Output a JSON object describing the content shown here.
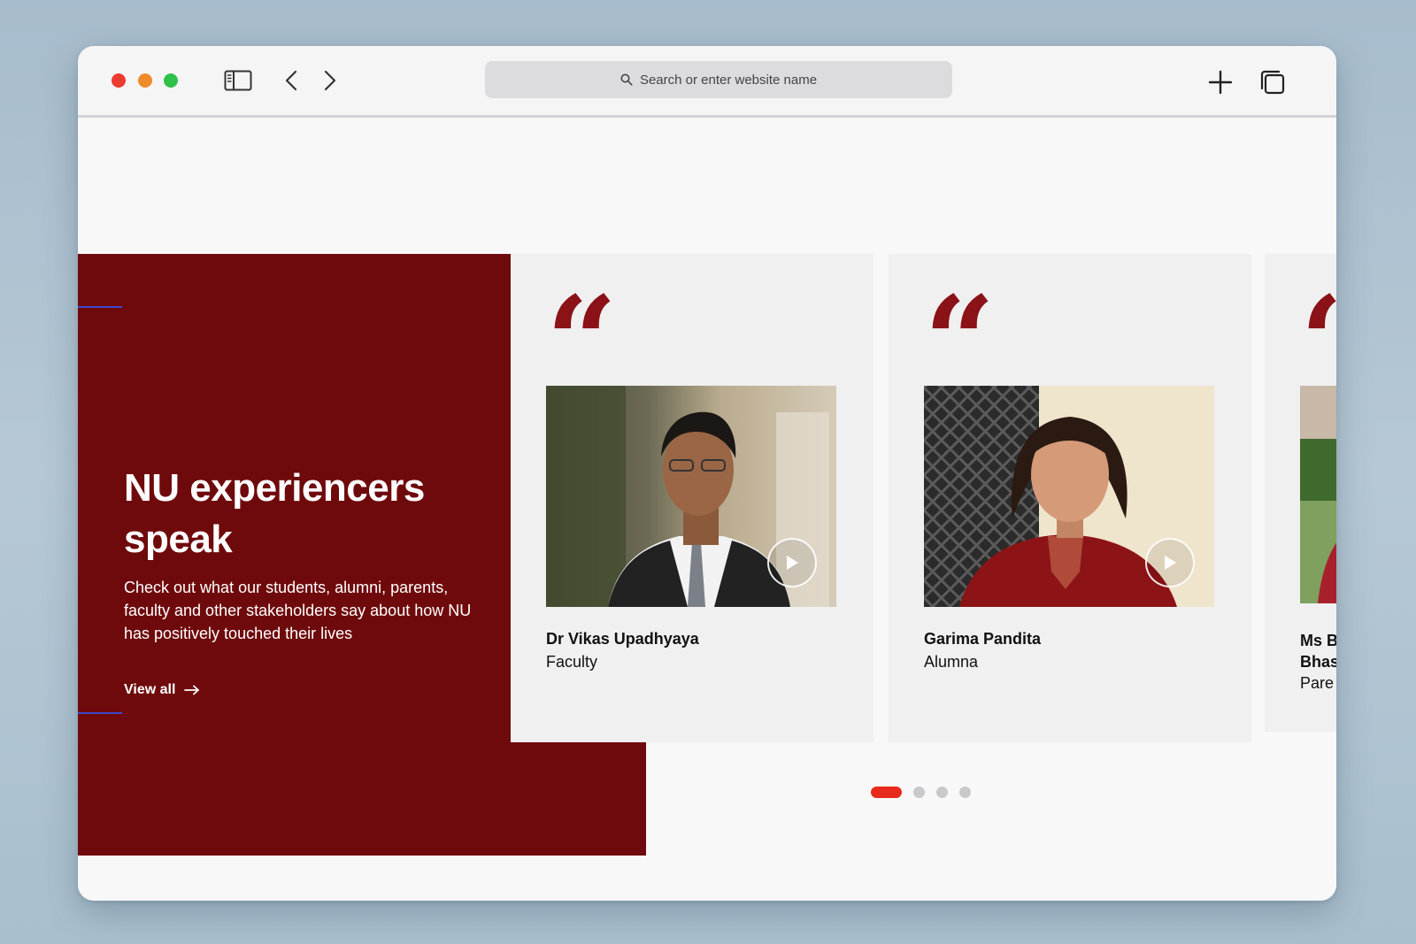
{
  "browser": {
    "address_placeholder": "Search or enter website name"
  },
  "hero": {
    "title": "NU experiencers speak",
    "description": "Check out what our students, alumni, parents, faculty and other stakeholders say about how NU has positively touched their lives",
    "link_label": "View all",
    "background_color": "#6f0a0c"
  },
  "testimonials": [
    {
      "name": "Dr Vikas Upadhyaya",
      "role": "Faculty"
    },
    {
      "name": "Garima Pandita",
      "role": "Alumna"
    },
    {
      "name_line1": "Ms B",
      "name_line2": "Bhas",
      "role": "Pare"
    }
  ],
  "carousel": {
    "page_count": 4,
    "active_page": 1
  },
  "colors": {
    "accent": "#e82a1c",
    "quote": "#8b1217"
  },
  "icons": [
    "search-icon",
    "sidebar-icon",
    "back-icon",
    "forward-icon",
    "plus-icon",
    "tabs-icon",
    "arrow-right-icon",
    "play-icon"
  ]
}
